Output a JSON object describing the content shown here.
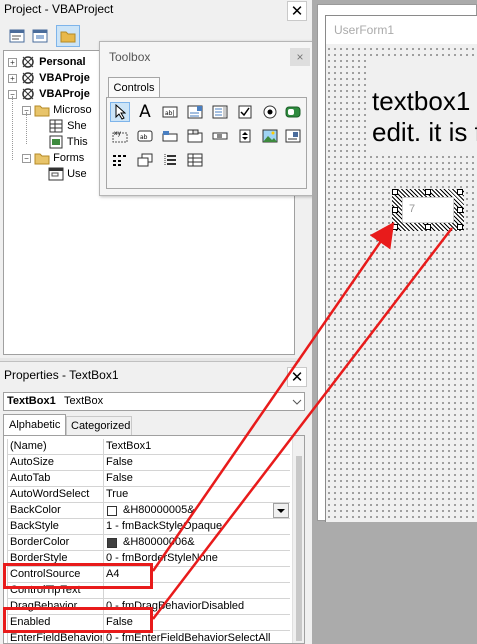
{
  "project": {
    "title": "Project - VBAProject",
    "close": "✕",
    "tree": [
      {
        "label": "Personal",
        "bold": true
      },
      {
        "label": "VBAProje",
        "bold": true
      },
      {
        "label": "VBAProje",
        "bold": true
      },
      {
        "label": "Microso"
      },
      {
        "label": "She"
      },
      {
        "label": "This"
      },
      {
        "label": "Forms"
      },
      {
        "label": "Use"
      }
    ]
  },
  "toolbox": {
    "title": "Toolbox",
    "close": "×",
    "tab": "Controls",
    "tools": [
      "select-objects-icon",
      "label-icon",
      "textbox-icon",
      "combobox-icon",
      "listbox-icon",
      "checkbox-icon",
      "optionbutton-icon",
      "togglebutton-icon",
      "frame-icon",
      "commandbutton-icon",
      "tabstrip-icon",
      "multipage-icon",
      "scrollbar-icon",
      "spinbutton-icon",
      "image-icon",
      "refedit-icon",
      "extra-icon-1",
      "extra-icon-2",
      "extra-icon-3",
      "extra-icon-4"
    ],
    "label_glyph": "A",
    "textbox_glyph": "ab|",
    "frame_glyph": "xy",
    "command_glyph": "ab"
  },
  "properties": {
    "title": "Properties - TextBox1",
    "close": "✕",
    "object_name": "TextBox1",
    "object_type": "TextBox",
    "tabs": [
      "Alphabetic",
      "Categorized"
    ],
    "rows": [
      {
        "name": "(Name)",
        "value": "TextBox1"
      },
      {
        "name": "AutoSize",
        "value": "False"
      },
      {
        "name": "AutoTab",
        "value": "False"
      },
      {
        "name": "AutoWordSelect",
        "value": "True"
      },
      {
        "name": "BackColor",
        "value": "&H80000005&",
        "swatch": "#ffffff",
        "dropdown": true
      },
      {
        "name": "BackStyle",
        "value": "1 - fmBackStyleOpaque"
      },
      {
        "name": "BorderColor",
        "value": "&H80000006&",
        "swatch": "#404040"
      },
      {
        "name": "BorderStyle",
        "value": "0 - fmBorderStyleNone"
      },
      {
        "name": "ControlSource",
        "value": "A4"
      },
      {
        "name": "ControlTipText",
        "value": ""
      },
      {
        "name": "DragBehavior",
        "value": "0 - fmDragBehaviorDisabled"
      },
      {
        "name": "Enabled",
        "value": "False"
      },
      {
        "name": "EnterFieldBehavior",
        "value": "0 - fmEnterFieldBehaviorSelectAll"
      }
    ]
  },
  "userform": {
    "title": "UserForm1",
    "caption_line1": "textbox1",
    "caption_line2": "edit. it is f",
    "textbox_value": "7"
  },
  "colors": {
    "highlight": "#e81b1b",
    "selection": "#cce4f7"
  }
}
